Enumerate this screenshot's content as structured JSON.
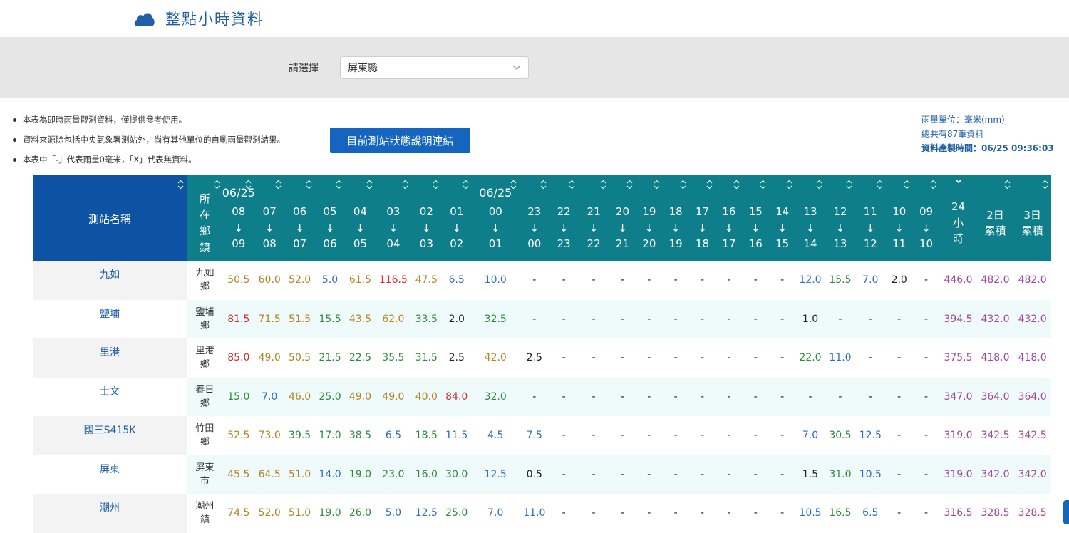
{
  "header": {
    "title": "整點小時資料",
    "icon": "cloud-icon",
    "brand_color": "#1f5fa8"
  },
  "filter": {
    "label": "請選擇",
    "selected": "屏東縣"
  },
  "notes": [
    "本表為即時雨量觀測資料，僅提供參考使用。",
    "資料來源除包括中央氣象署測站外，尚有其他單位的自動雨量觀測結果。",
    "本表中「-」代表雨量0毫米，「X」代表無資料。"
  ],
  "status_link": "目前測站狀態說明連結",
  "meta": {
    "unit": "雨量單位：毫米(mm)",
    "count": "總共有87筆資料",
    "generated": "資料產製時間：06/25 09:36:03"
  },
  "table": {
    "station_header": "測站名稱",
    "town_header": "所在鄉鎮",
    "dates": [
      "06/25",
      "06/25"
    ],
    "hour_headers": [
      [
        "08",
        "09"
      ],
      [
        "07",
        "08"
      ],
      [
        "06",
        "07"
      ],
      [
        "05",
        "06"
      ],
      [
        "04",
        "05"
      ],
      [
        "03",
        "04"
      ],
      [
        "02",
        "03"
      ],
      [
        "01",
        "02"
      ],
      [
        "00",
        "01"
      ],
      [
        "23",
        "00"
      ],
      [
        "22",
        "23"
      ],
      [
        "21",
        "22"
      ],
      [
        "20",
        "21"
      ],
      [
        "19",
        "20"
      ],
      [
        "18",
        "19"
      ],
      [
        "17",
        "18"
      ],
      [
        "16",
        "17"
      ],
      [
        "15",
        "16"
      ],
      [
        "14",
        "15"
      ],
      [
        "13",
        "14"
      ],
      [
        "12",
        "13"
      ],
      [
        "11",
        "12"
      ],
      [
        "10",
        "11"
      ],
      [
        "09",
        "10"
      ]
    ],
    "arrow": "↓",
    "total_headers": [
      "24小時",
      "2日累積",
      "3日累積"
    ],
    "rows": [
      {
        "station": "九如",
        "town": "九如鄉",
        "values": [
          "50.5",
          "60.0",
          "52.0",
          "5.0",
          "61.5",
          "116.5",
          "47.5",
          "6.5",
          "10.0",
          "-",
          "-",
          "-",
          "-",
          "-",
          "-",
          "-",
          "-",
          "-",
          "-",
          "12.0",
          "15.5",
          "7.0",
          "2.0",
          "-"
        ],
        "colors": [
          "org",
          "org",
          "org",
          "blu",
          "org",
          "red",
          "org",
          "blu",
          "blu",
          "blk",
          "blk",
          "blk",
          "blk",
          "blk",
          "blk",
          "blk",
          "blk",
          "blk",
          "blk",
          "blu",
          "grn",
          "blu",
          "blk",
          "blk"
        ],
        "totals": [
          "446.0",
          "482.0",
          "482.0"
        ]
      },
      {
        "station": "鹽埔",
        "town": "鹽埔鄉",
        "values": [
          "81.5",
          "71.5",
          "51.5",
          "15.5",
          "43.5",
          "62.0",
          "33.5",
          "2.0",
          "32.5",
          "-",
          "-",
          "-",
          "-",
          "-",
          "-",
          "-",
          "-",
          "-",
          "-",
          "1.0",
          "-",
          "-",
          "-",
          "-"
        ],
        "colors": [
          "red",
          "org",
          "org",
          "grn",
          "org",
          "org",
          "grn",
          "blk",
          "grn",
          "blk",
          "blk",
          "blk",
          "blk",
          "blk",
          "blk",
          "blk",
          "blk",
          "blk",
          "blk",
          "blk",
          "blk",
          "blk",
          "blk",
          "blk"
        ],
        "totals": [
          "394.5",
          "432.0",
          "432.0"
        ]
      },
      {
        "station": "里港",
        "town": "里港鄉",
        "values": [
          "85.0",
          "49.0",
          "50.5",
          "21.5",
          "22.5",
          "35.5",
          "31.5",
          "2.5",
          "42.0",
          "2.5",
          "-",
          "-",
          "-",
          "-",
          "-",
          "-",
          "-",
          "-",
          "-",
          "22.0",
          "11.0",
          "-",
          "-",
          "-"
        ],
        "colors": [
          "red",
          "org",
          "org",
          "grn",
          "grn",
          "grn",
          "grn",
          "blk",
          "org",
          "blk",
          "blk",
          "blk",
          "blk",
          "blk",
          "blk",
          "blk",
          "blk",
          "blk",
          "blk",
          "grn",
          "blu",
          "blk",
          "blk",
          "blk"
        ],
        "totals": [
          "375.5",
          "418.0",
          "418.0"
        ]
      },
      {
        "station": "士文",
        "town": "春日鄉",
        "values": [
          "15.0",
          "7.0",
          "46.0",
          "25.0",
          "49.0",
          "49.0",
          "40.0",
          "84.0",
          "32.0",
          "-",
          "-",
          "-",
          "-",
          "-",
          "-",
          "-",
          "-",
          "-",
          "-",
          "-",
          "-",
          "-",
          "-",
          "-"
        ],
        "colors": [
          "grn",
          "blu",
          "org",
          "grn",
          "org",
          "org",
          "org",
          "red",
          "grn",
          "blk",
          "blk",
          "blk",
          "blk",
          "blk",
          "blk",
          "blk",
          "blk",
          "blk",
          "blk",
          "blk",
          "blk",
          "blk",
          "blk",
          "blk"
        ],
        "totals": [
          "347.0",
          "364.0",
          "364.0"
        ]
      },
      {
        "station": "國三S415K",
        "town": "竹田鄉",
        "values": [
          "52.5",
          "73.0",
          "39.5",
          "17.0",
          "38.5",
          "6.5",
          "18.5",
          "11.5",
          "4.5",
          "7.5",
          "-",
          "-",
          "-",
          "-",
          "-",
          "-",
          "-",
          "-",
          "-",
          "7.0",
          "30.5",
          "12.5",
          "-",
          "-"
        ],
        "colors": [
          "org",
          "org",
          "grn",
          "grn",
          "grn",
          "blu",
          "grn",
          "blu",
          "blu",
          "blu",
          "blk",
          "blk",
          "blk",
          "blk",
          "blk",
          "blk",
          "blk",
          "blk",
          "blk",
          "blu",
          "grn",
          "blu",
          "blk",
          "blk"
        ],
        "totals": [
          "319.0",
          "342.5",
          "342.5"
        ]
      },
      {
        "station": "屏東",
        "town": "屏東市",
        "values": [
          "45.5",
          "64.5",
          "51.0",
          "14.0",
          "19.0",
          "23.0",
          "16.0",
          "30.0",
          "12.5",
          "0.5",
          "-",
          "-",
          "-",
          "-",
          "-",
          "-",
          "-",
          "-",
          "-",
          "1.5",
          "31.0",
          "10.5",
          "-",
          "-"
        ],
        "colors": [
          "org",
          "org",
          "org",
          "blu",
          "grn",
          "grn",
          "grn",
          "grn",
          "blu",
          "blk",
          "blk",
          "blk",
          "blk",
          "blk",
          "blk",
          "blk",
          "blk",
          "blk",
          "blk",
          "blk",
          "grn",
          "blu",
          "blk",
          "blk"
        ],
        "totals": [
          "319.0",
          "342.0",
          "342.0"
        ]
      },
      {
        "station": "潮州",
        "town": "潮州鎮",
        "values": [
          "74.5",
          "52.0",
          "51.0",
          "19.0",
          "26.0",
          "5.0",
          "12.5",
          "25.0",
          "7.0",
          "11.0",
          "-",
          "-",
          "-",
          "-",
          "-",
          "-",
          "-",
          "-",
          "-",
          "10.5",
          "16.5",
          "6.5",
          "-",
          "-"
        ],
        "colors": [
          "org",
          "org",
          "org",
          "grn",
          "grn",
          "blu",
          "blu",
          "grn",
          "blu",
          "blu",
          "blk",
          "blk",
          "blk",
          "blk",
          "blk",
          "blk",
          "blk",
          "blk",
          "blk",
          "blu",
          "grn",
          "blu",
          "blk",
          "blk"
        ],
        "totals": [
          "316.5",
          "328.5",
          "328.5"
        ]
      }
    ]
  },
  "colors": {
    "station_header_bg": "#0d52a3",
    "header_bg": "#0f7e8b",
    "link_button_bg": "#1565c0",
    "red": "#d32f2f",
    "orange": "#b58422",
    "green": "#2e8b3a",
    "blue": "#2d6ec5",
    "purple": "#a2479b"
  }
}
